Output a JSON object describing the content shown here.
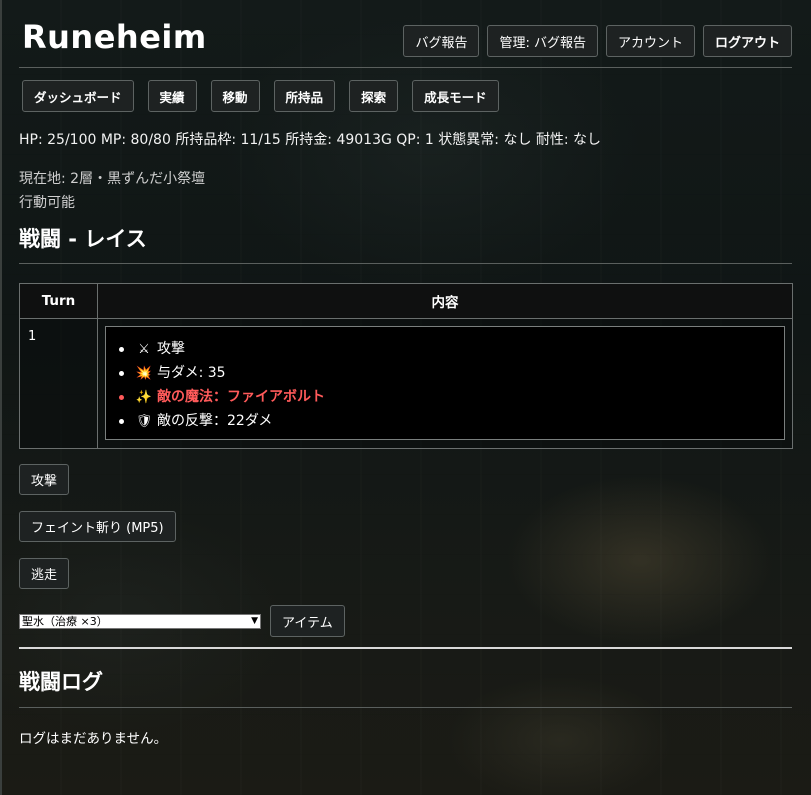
{
  "app": {
    "title": "Runeheim"
  },
  "header_buttons": [
    {
      "label": "バグ報告"
    },
    {
      "label": "管理: バグ報告"
    },
    {
      "label": "アカウント"
    },
    {
      "label": "ログアウト"
    }
  ],
  "nav": [
    {
      "label": "ダッシュボード"
    },
    {
      "label": "実績"
    },
    {
      "label": "移動"
    },
    {
      "label": "所持品"
    },
    {
      "label": "探索"
    },
    {
      "label": "成長モード"
    }
  ],
  "status": {
    "line": "HP: 25/100 MP: 80/80 所持品枠: 11/15 所持金: 49013G QP: 1 状態異常: なし 耐性: なし"
  },
  "location": {
    "current": "現在地: 2層・黒ずんだ小祭壇",
    "state": "行動可能"
  },
  "battle": {
    "title": "戦闘 - レイス",
    "table": {
      "headers": {
        "turn": "Turn",
        "content": "内容"
      },
      "rows": [
        {
          "turn": "1",
          "events": [
            {
              "icon": "⚔",
              "icon_name": "crossed-swords-icon",
              "text": "攻撃",
              "style": "normal"
            },
            {
              "icon": "💥",
              "icon_name": "damage-burst-icon",
              "text": "与ダメ: 35",
              "style": "normal"
            },
            {
              "icon": "✨",
              "icon_name": "sparkles-icon",
              "text": "敵の魔法：ファイアボルト",
              "style": "magic"
            },
            {
              "icon": "🛡",
              "icon_name": "shield-icon",
              "text": "敵の反撃：22ダメ",
              "style": "normal"
            }
          ]
        }
      ]
    },
    "actions": {
      "attack": "攻撃",
      "feint": "フェイント斬り (MP5)",
      "flee": "逃走"
    },
    "item": {
      "selected": "聖水（治療 ×3）",
      "use_label": "アイテム"
    }
  },
  "battle_log": {
    "title": "戦闘ログ",
    "empty_text": "ログはまだありません。"
  },
  "colors": {
    "magic": "#ff5a5a",
    "button_bg": "#1e2222",
    "border": "#5d6362"
  }
}
